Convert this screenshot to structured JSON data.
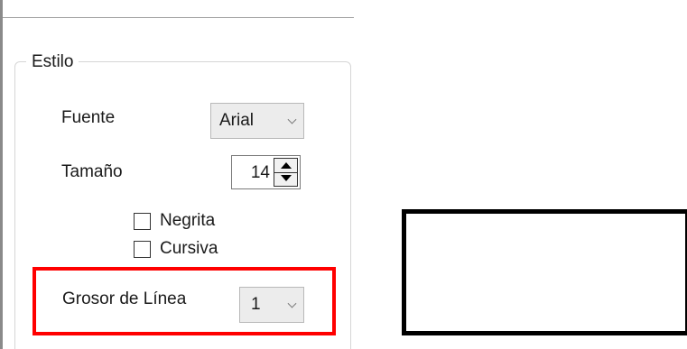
{
  "style_group": {
    "title": "Estilo",
    "font": {
      "label": "Fuente",
      "value": "Arial"
    },
    "size": {
      "label": "Tamaño",
      "value": "14"
    },
    "bold": {
      "label": "Negrita",
      "checked": false
    },
    "italic": {
      "label": "Cursiva",
      "checked": false
    },
    "line_width": {
      "label": "Grosor de Línea",
      "value": "1"
    }
  },
  "colors": {
    "highlight": "#ff0000",
    "combo_bg": "#ececec",
    "preview_border": "#000000"
  },
  "icons": {
    "combo_chevron": "chevron-down-icon",
    "spin_up": "arrow-up-icon",
    "spin_down": "arrow-down-icon"
  }
}
